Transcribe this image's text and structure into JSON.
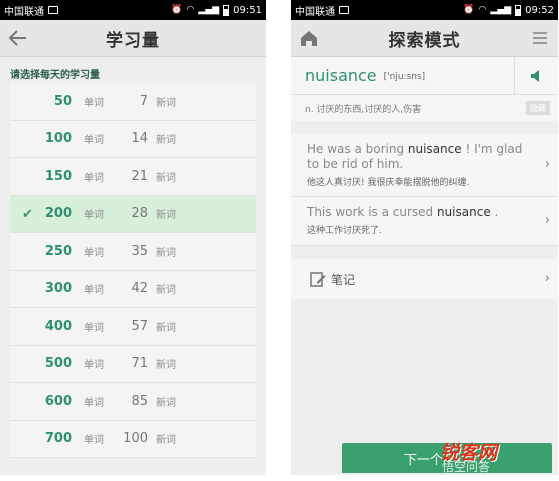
{
  "status_left": {
    "carrier": "中国联通",
    "time": "09:51"
  },
  "status_right": {
    "carrier": "中国联通",
    "time": "09:52"
  },
  "left_screen": {
    "title": "学习量",
    "prompt": "请选择每天的学习量",
    "rows": [
      {
        "words": "50",
        "unit1": "单词",
        "new": "7",
        "unit2": "新词",
        "selected": false
      },
      {
        "words": "100",
        "unit1": "单词",
        "new": "14",
        "unit2": "新词",
        "selected": false
      },
      {
        "words": "150",
        "unit1": "单词",
        "new": "21",
        "unit2": "新词",
        "selected": false
      },
      {
        "words": "200",
        "unit1": "单词",
        "new": "28",
        "unit2": "新词",
        "selected": true
      },
      {
        "words": "250",
        "unit1": "单词",
        "new": "35",
        "unit2": "新词",
        "selected": false
      },
      {
        "words": "300",
        "unit1": "单词",
        "new": "42",
        "unit2": "新词",
        "selected": false
      },
      {
        "words": "400",
        "unit1": "单词",
        "new": "57",
        "unit2": "新词",
        "selected": false
      },
      {
        "words": "500",
        "unit1": "单词",
        "new": "71",
        "unit2": "新词",
        "selected": false
      },
      {
        "words": "600",
        "unit1": "单词",
        "new": "85",
        "unit2": "新词",
        "selected": false
      },
      {
        "words": "700",
        "unit1": "单词",
        "new": "100",
        "unit2": "新词",
        "selected": false
      }
    ]
  },
  "right_screen": {
    "title": "探索模式",
    "word": "nuisance",
    "phonetic": "['nju:sns]",
    "definition": "n. 讨厌的东西,讨厌的人,伤害",
    "hide_button": "隐藏",
    "examples": [
      {
        "pre": "He was a boring ",
        "key": "nuisance",
        "post": " ! I'm glad to be rid of him.",
        "zh": "他这人真讨厌! 我很庆幸能摆脱他的纠缠."
      },
      {
        "pre": "This work is a cursed ",
        "key": "nuisance",
        "post": " .",
        "zh": "这种工作讨厌死了."
      }
    ],
    "note_label": "笔记",
    "next_button": "下一个"
  },
  "watermark": {
    "brand": "锐客网",
    "sub": "悟空问答"
  },
  "colors": {
    "accent": "#2e8f72",
    "selected_row": "#d8efda",
    "next_button": "#3aa06e"
  }
}
